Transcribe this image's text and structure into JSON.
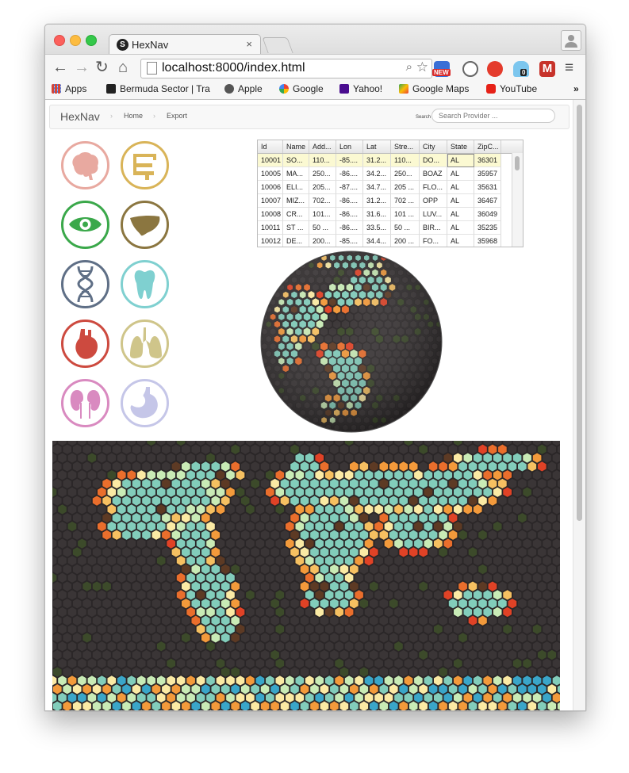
{
  "browser": {
    "tab_title": "HexNav",
    "tab_favicon": "S",
    "tab_close": "×",
    "url": "localhost:8000/index.html",
    "nav": {
      "back": "←",
      "forward": "→",
      "reload": "↻",
      "home": "⌂",
      "menu": "≡"
    },
    "extensions": {
      "new_badge": "NEW",
      "ghost_badge": "0",
      "m_label": "M"
    },
    "bookmarks": [
      {
        "label": "Apps",
        "icon": "apps-grid-icon",
        "color": "#d44638"
      },
      {
        "label": "Bermuda Sector | Tra",
        "icon": "trello-icon",
        "color": "#222222"
      },
      {
        "label": "Apple",
        "icon": "apple-icon",
        "color": "#555555"
      },
      {
        "label": "Google",
        "icon": "google-icon",
        "color": "#4285f4"
      },
      {
        "label": "Yahoo!",
        "icon": "yahoo-icon",
        "color": "#4a0d8f"
      },
      {
        "label": "Google Maps",
        "icon": "maps-icon",
        "color": "#34a853"
      },
      {
        "label": "YouTube",
        "icon": "youtube-icon",
        "color": "#e62117"
      }
    ],
    "bookmarks_overflow": "»"
  },
  "app": {
    "brand": "HexNav",
    "nav_links": [
      "Home",
      "Export"
    ],
    "search_label": "Search",
    "search_placeholder": "Search Provider ..."
  },
  "organs": [
    {
      "name": "brain-icon",
      "color": "#e8a9a0"
    },
    {
      "name": "intestines-icon",
      "color": "#d9b458"
    },
    {
      "name": "eye-icon",
      "color": "#3aa84a"
    },
    {
      "name": "liver-icon",
      "color": "#8b7640"
    },
    {
      "name": "dna-icon",
      "color": "#5f6f86"
    },
    {
      "name": "tooth-icon",
      "color": "#7fd0d0"
    },
    {
      "name": "heart-icon",
      "color": "#cd4a3f"
    },
    {
      "name": "lungs-icon",
      "color": "#cfc58a"
    },
    {
      "name": "kidneys-icon",
      "color": "#d98ac0"
    },
    {
      "name": "stomach-icon",
      "color": "#c5c6e8"
    }
  ],
  "grid": {
    "columns": [
      "Id",
      "Name",
      "Add...",
      "Lon",
      "Lat",
      "Stre...",
      "City",
      "State",
      "ZipC..."
    ],
    "rows": [
      [
        "10001",
        "SO...",
        "110...",
        "-85....",
        "31.2...",
        "110...",
        "DO...",
        "AL",
        "36301"
      ],
      [
        "10005",
        "MA...",
        "250...",
        "-86....",
        "34.2...",
        "250...",
        "BOAZ",
        "AL",
        "35957"
      ],
      [
        "10006",
        "ELI...",
        "205...",
        "-87....",
        "34.7...",
        "205 ...",
        "FLO...",
        "AL",
        "35631"
      ],
      [
        "10007",
        "MIZ...",
        "702...",
        "-86....",
        "31.2...",
        "702 ...",
        "OPP",
        "AL",
        "36467"
      ],
      [
        "10008",
        "CR...",
        "101...",
        "-86....",
        "31.6...",
        "101 ...",
        "LUV...",
        "AL",
        "36049"
      ],
      [
        "10011",
        "ST ...",
        "50 ...",
        "-86....",
        "33.5...",
        "50 ...",
        "BIR...",
        "AL",
        "35235"
      ],
      [
        "10012",
        "DE...",
        "200...",
        "-85....",
        "34.4...",
        "200 ...",
        "FO...",
        "AL",
        "35968"
      ]
    ]
  },
  "map_palette": {
    "background": "#2f2b2c",
    "ocean_hex": "#3a3536",
    "land": [
      "#e04226",
      "#ea6e2c",
      "#f39a3b",
      "#f6c061",
      "#fbeaa4",
      "#c9ebb6",
      "#82cdbb",
      "#3aa6c9",
      "#5d3a24",
      "#3c4a2a"
    ]
  }
}
